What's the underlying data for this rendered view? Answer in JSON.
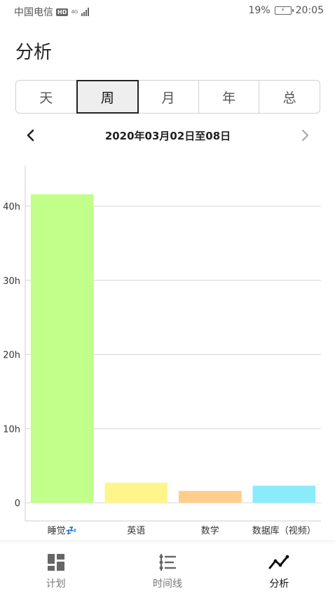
{
  "status": {
    "carrier": "中国电信",
    "hd": "HD",
    "network": "4G",
    "battery_pct": "19%",
    "time": "20:05"
  },
  "title": "分析",
  "tabs": [
    {
      "label": "天",
      "active": false
    },
    {
      "label": "周",
      "active": true
    },
    {
      "label": "月",
      "active": false
    },
    {
      "label": "年",
      "active": false
    },
    {
      "label": "总",
      "active": false
    }
  ],
  "date_range": "2020年03月02日至08日",
  "icons": {
    "prev": "chevron-left-icon",
    "next": "chevron-right-icon",
    "plan": "dashboard-grid-icon",
    "timeline": "timeline-list-icon",
    "analysis": "trend-line-icon"
  },
  "chart_data": {
    "type": "bar",
    "categories": [
      "睡觉💤",
      "英语",
      "数学",
      "数据库（视频）"
    ],
    "values": [
      41.6,
      2.7,
      1.6,
      2.3
    ],
    "colors": [
      "#c1ff8a",
      "#fff58a",
      "#ffce8a",
      "#8aebfb"
    ],
    "yticks": [
      "0",
      "10h",
      "20h",
      "30h",
      "40h"
    ],
    "ylim": [
      0,
      46
    ],
    "grid": true
  },
  "bottom_nav": [
    {
      "label": "计划",
      "active": false
    },
    {
      "label": "时间线",
      "active": false
    },
    {
      "label": "分析",
      "active": true
    }
  ]
}
